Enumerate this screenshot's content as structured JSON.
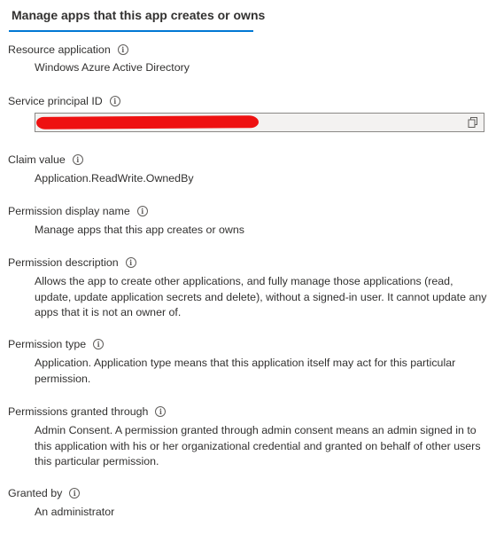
{
  "header": {
    "title": "Manage apps that this app creates or owns"
  },
  "fields": [
    {
      "label": "Resource application",
      "value": "Windows Azure Active Directory"
    },
    {
      "label": "Service principal ID",
      "value": ""
    },
    {
      "label": "Claim value",
      "value": "Application.ReadWrite.OwnedBy"
    },
    {
      "label": "Permission display name",
      "value": "Manage apps that this app creates or owns"
    },
    {
      "label": "Permission description",
      "value": "Allows the app to create other applications, and fully manage those applications (read, update, update application secrets and delete), without a signed-in user. It cannot update any apps that it is not an owner of."
    },
    {
      "label": "Permission type",
      "value": "Application. Application type means that this application itself may act for this particular permission."
    },
    {
      "label": "Permissions granted through",
      "value": "Admin Consent. A permission granted through admin consent means an admin signed in to this application with his or her organizational credential and granted on behalf of other users this particular permission."
    },
    {
      "label": "Granted by",
      "value": "An administrator"
    }
  ],
  "icons": {
    "info": "info-icon",
    "copy": "copy-icon"
  },
  "colors": {
    "accent": "#0078d4",
    "redaction": "#ee1111",
    "text": "#323130"
  }
}
